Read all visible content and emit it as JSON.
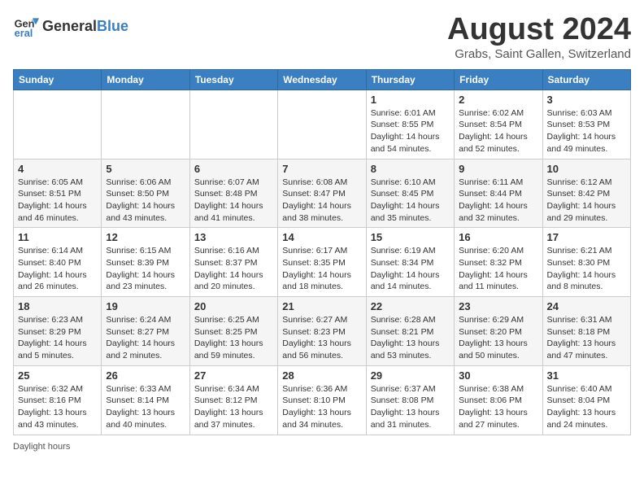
{
  "header": {
    "logo_general": "General",
    "logo_blue": "Blue",
    "month_title": "August 2024",
    "location": "Grabs, Saint Gallen, Switzerland"
  },
  "days_of_week": [
    "Sunday",
    "Monday",
    "Tuesday",
    "Wednesday",
    "Thursday",
    "Friday",
    "Saturday"
  ],
  "weeks": [
    [
      {
        "day": "",
        "info": ""
      },
      {
        "day": "",
        "info": ""
      },
      {
        "day": "",
        "info": ""
      },
      {
        "day": "",
        "info": ""
      },
      {
        "day": "1",
        "info": "Sunrise: 6:01 AM\nSunset: 8:55 PM\nDaylight: 14 hours\nand 54 minutes."
      },
      {
        "day": "2",
        "info": "Sunrise: 6:02 AM\nSunset: 8:54 PM\nDaylight: 14 hours\nand 52 minutes."
      },
      {
        "day": "3",
        "info": "Sunrise: 6:03 AM\nSunset: 8:53 PM\nDaylight: 14 hours\nand 49 minutes."
      }
    ],
    [
      {
        "day": "4",
        "info": "Sunrise: 6:05 AM\nSunset: 8:51 PM\nDaylight: 14 hours\nand 46 minutes."
      },
      {
        "day": "5",
        "info": "Sunrise: 6:06 AM\nSunset: 8:50 PM\nDaylight: 14 hours\nand 43 minutes."
      },
      {
        "day": "6",
        "info": "Sunrise: 6:07 AM\nSunset: 8:48 PM\nDaylight: 14 hours\nand 41 minutes."
      },
      {
        "day": "7",
        "info": "Sunrise: 6:08 AM\nSunset: 8:47 PM\nDaylight: 14 hours\nand 38 minutes."
      },
      {
        "day": "8",
        "info": "Sunrise: 6:10 AM\nSunset: 8:45 PM\nDaylight: 14 hours\nand 35 minutes."
      },
      {
        "day": "9",
        "info": "Sunrise: 6:11 AM\nSunset: 8:44 PM\nDaylight: 14 hours\nand 32 minutes."
      },
      {
        "day": "10",
        "info": "Sunrise: 6:12 AM\nSunset: 8:42 PM\nDaylight: 14 hours\nand 29 minutes."
      }
    ],
    [
      {
        "day": "11",
        "info": "Sunrise: 6:14 AM\nSunset: 8:40 PM\nDaylight: 14 hours\nand 26 minutes."
      },
      {
        "day": "12",
        "info": "Sunrise: 6:15 AM\nSunset: 8:39 PM\nDaylight: 14 hours\nand 23 minutes."
      },
      {
        "day": "13",
        "info": "Sunrise: 6:16 AM\nSunset: 8:37 PM\nDaylight: 14 hours\nand 20 minutes."
      },
      {
        "day": "14",
        "info": "Sunrise: 6:17 AM\nSunset: 8:35 PM\nDaylight: 14 hours\nand 18 minutes."
      },
      {
        "day": "15",
        "info": "Sunrise: 6:19 AM\nSunset: 8:34 PM\nDaylight: 14 hours\nand 14 minutes."
      },
      {
        "day": "16",
        "info": "Sunrise: 6:20 AM\nSunset: 8:32 PM\nDaylight: 14 hours\nand 11 minutes."
      },
      {
        "day": "17",
        "info": "Sunrise: 6:21 AM\nSunset: 8:30 PM\nDaylight: 14 hours\nand 8 minutes."
      }
    ],
    [
      {
        "day": "18",
        "info": "Sunrise: 6:23 AM\nSunset: 8:29 PM\nDaylight: 14 hours\nand 5 minutes."
      },
      {
        "day": "19",
        "info": "Sunrise: 6:24 AM\nSunset: 8:27 PM\nDaylight: 14 hours\nand 2 minutes."
      },
      {
        "day": "20",
        "info": "Sunrise: 6:25 AM\nSunset: 8:25 PM\nDaylight: 13 hours\nand 59 minutes."
      },
      {
        "day": "21",
        "info": "Sunrise: 6:27 AM\nSunset: 8:23 PM\nDaylight: 13 hours\nand 56 minutes."
      },
      {
        "day": "22",
        "info": "Sunrise: 6:28 AM\nSunset: 8:21 PM\nDaylight: 13 hours\nand 53 minutes."
      },
      {
        "day": "23",
        "info": "Sunrise: 6:29 AM\nSunset: 8:20 PM\nDaylight: 13 hours\nand 50 minutes."
      },
      {
        "day": "24",
        "info": "Sunrise: 6:31 AM\nSunset: 8:18 PM\nDaylight: 13 hours\nand 47 minutes."
      }
    ],
    [
      {
        "day": "25",
        "info": "Sunrise: 6:32 AM\nSunset: 8:16 PM\nDaylight: 13 hours\nand 43 minutes."
      },
      {
        "day": "26",
        "info": "Sunrise: 6:33 AM\nSunset: 8:14 PM\nDaylight: 13 hours\nand 40 minutes."
      },
      {
        "day": "27",
        "info": "Sunrise: 6:34 AM\nSunset: 8:12 PM\nDaylight: 13 hours\nand 37 minutes."
      },
      {
        "day": "28",
        "info": "Sunrise: 6:36 AM\nSunset: 8:10 PM\nDaylight: 13 hours\nand 34 minutes."
      },
      {
        "day": "29",
        "info": "Sunrise: 6:37 AM\nSunset: 8:08 PM\nDaylight: 13 hours\nand 31 minutes."
      },
      {
        "day": "30",
        "info": "Sunrise: 6:38 AM\nSunset: 8:06 PM\nDaylight: 13 hours\nand 27 minutes."
      },
      {
        "day": "31",
        "info": "Sunrise: 6:40 AM\nSunset: 8:04 PM\nDaylight: 13 hours\nand 24 minutes."
      }
    ]
  ],
  "footer": {
    "daylight_label": "Daylight hours"
  }
}
